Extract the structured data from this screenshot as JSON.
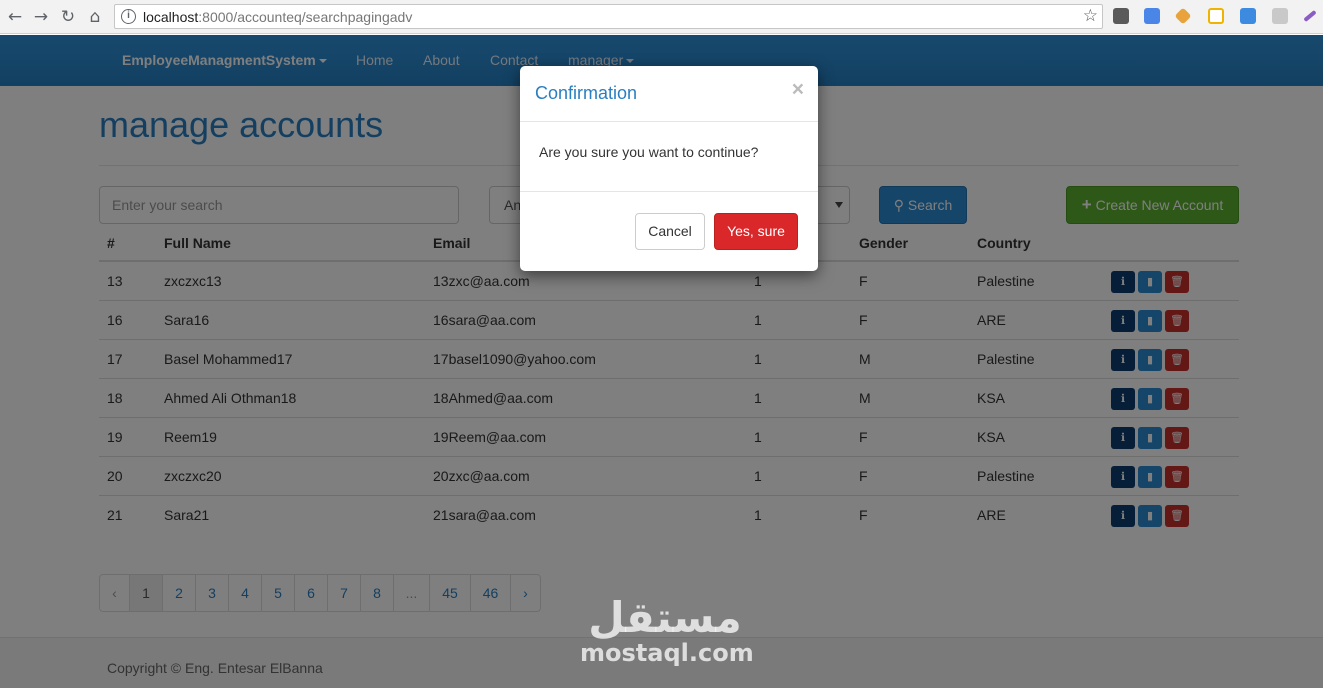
{
  "browser": {
    "url_host": "localhost",
    "url_path": ":8000/accounteq/searchpagingadv"
  },
  "navbar": {
    "brand": "EmployeeManagmentSystem",
    "links": [
      "Home",
      "About",
      "Contact",
      "manager"
    ]
  },
  "page": {
    "title": "manage accounts"
  },
  "toolbar": {
    "search_placeholder": "Enter your search",
    "select_value": "An",
    "search_button": "Search",
    "create_button": "Create New Account"
  },
  "table": {
    "headers": [
      "#",
      "Full Name",
      "Email",
      "Gender",
      "Country"
    ],
    "rows": [
      {
        "id": "13",
        "name": "zxczxc13",
        "email": "13zxc@aa.com",
        "flag": "1",
        "gender": "F",
        "country": "Palestine"
      },
      {
        "id": "16",
        "name": "Sara16",
        "email": "16sara@aa.com",
        "flag": "1",
        "gender": "F",
        "country": "ARE"
      },
      {
        "id": "17",
        "name": "Basel Mohammed17",
        "email": "17basel1090@yahoo.com",
        "flag": "1",
        "gender": "M",
        "country": "Palestine"
      },
      {
        "id": "18",
        "name": "Ahmed Ali Othman18",
        "email": "18Ahmed@aa.com",
        "flag": "1",
        "gender": "M",
        "country": "KSA"
      },
      {
        "id": "19",
        "name": "Reem19",
        "email": "19Reem@aa.com",
        "flag": "1",
        "gender": "F",
        "country": "KSA"
      },
      {
        "id": "20",
        "name": "zxczxc20",
        "email": "20zxc@aa.com",
        "flag": "1",
        "gender": "F",
        "country": "Palestine"
      },
      {
        "id": "21",
        "name": "Sara21",
        "email": "21sara@aa.com",
        "flag": "1",
        "gender": "F",
        "country": "ARE"
      }
    ]
  },
  "pagination": [
    "‹",
    "1",
    "2",
    "3",
    "4",
    "5",
    "6",
    "7",
    "8",
    "...",
    "45",
    "46",
    "›"
  ],
  "footer": {
    "copyright": "Copyright © Eng. Entesar ElBanna"
  },
  "watermark": {
    "arabic": "مستقل",
    "latin": "mostaql.com"
  },
  "modal": {
    "title": "Confirmation",
    "close": "×",
    "message": "Are you sure you want to continue?",
    "cancel": "Cancel",
    "confirm": "Yes, sure"
  },
  "colors": {
    "primary": "#2a8ad1",
    "success": "#5cb030",
    "danger": "#d9272a",
    "dark_info": "#0d3d6e"
  }
}
